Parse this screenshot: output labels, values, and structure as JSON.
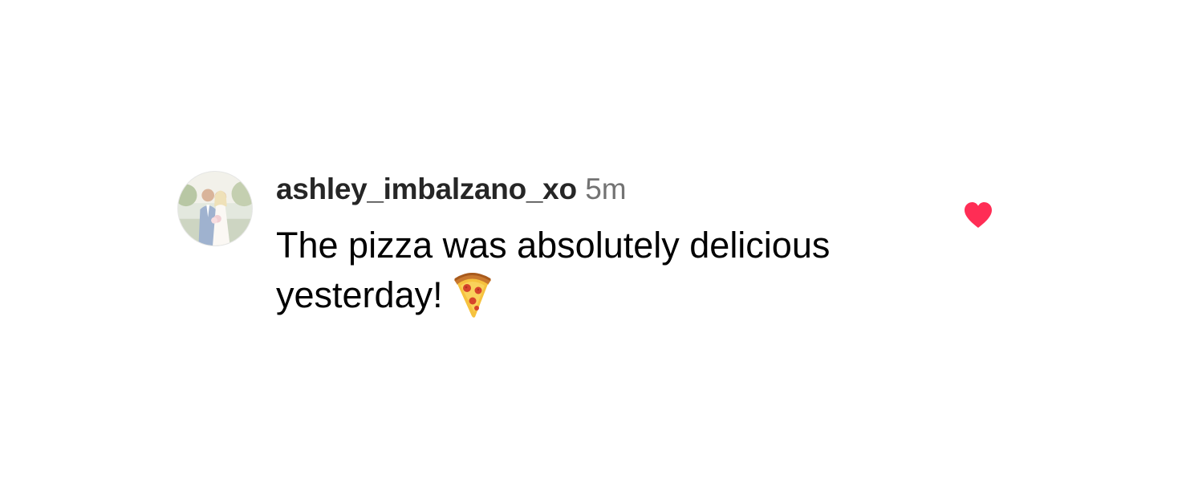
{
  "comment": {
    "username": "ashley_imbalzano_xo",
    "timestamp": "5m",
    "text": "The pizza was absolutely delicious yesterday!",
    "emoji_icon": "pizza-icon",
    "liked": true,
    "like_icon": "heart-icon"
  },
  "colors": {
    "username": "#262626",
    "timestamp": "#737373",
    "text": "#000000",
    "heart": "#ff2d55",
    "background": "#ffffff"
  }
}
